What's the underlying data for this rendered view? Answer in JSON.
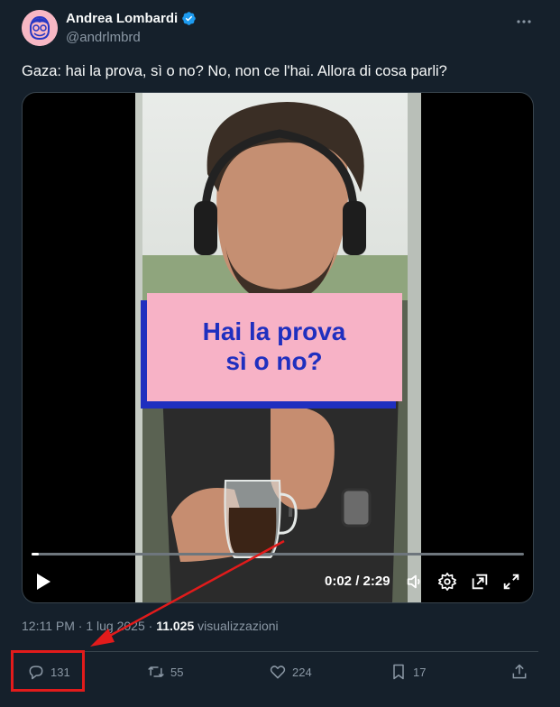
{
  "author": {
    "name": "Andrea Lombardi",
    "handle": "@andrlmbrd"
  },
  "tweet": {
    "text": "Gaza: hai la prova, sì o no? No, non ce l'hai. Allora di cosa parli?"
  },
  "video": {
    "caption_line1": "Hai la prova",
    "caption_line2": "sì o no?",
    "time": "0:02 / 2:29",
    "progress": 0.015
  },
  "meta": {
    "time": "12:11 PM",
    "date": "1 lug 2025",
    "views_count": "11.025",
    "views_label": "visualizzazioni"
  },
  "actions": {
    "replies": "131",
    "reposts": "55",
    "likes": "224",
    "bookmarks": "17"
  },
  "colors": {
    "background": "#15202b",
    "verified": "#1d9bf0",
    "caption_bg": "#f7b2c6",
    "caption_text": "#1f2fbf",
    "annotation": "#e21b1b"
  }
}
